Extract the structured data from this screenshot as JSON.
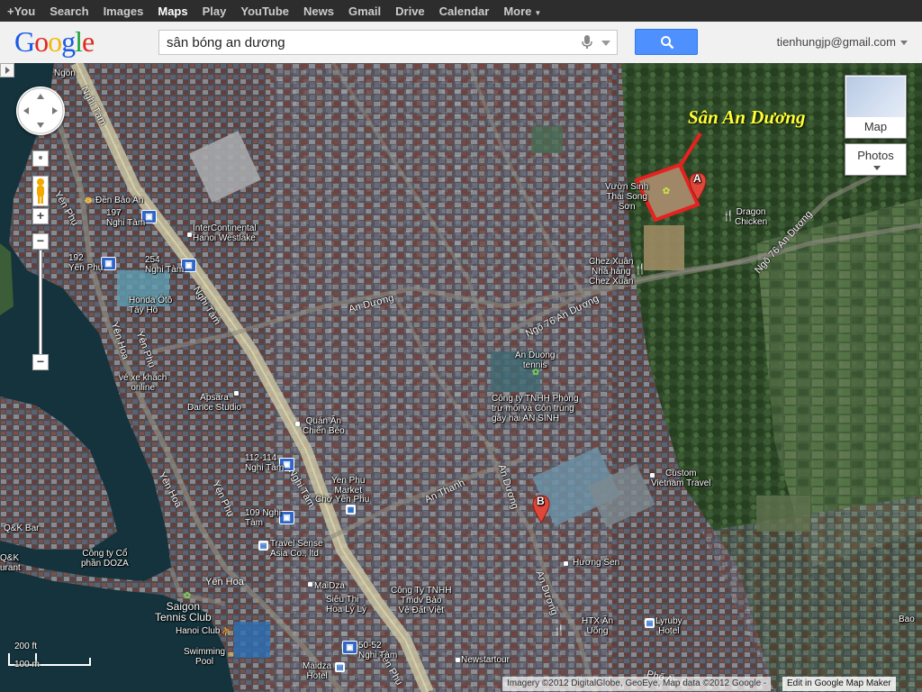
{
  "topbar": {
    "items": [
      "+You",
      "Search",
      "Images",
      "Maps",
      "Play",
      "YouTube",
      "News",
      "Gmail",
      "Drive",
      "Calendar",
      "More"
    ],
    "active": "Maps"
  },
  "header": {
    "logo": "Google",
    "search_value": "sân bóng an dương",
    "account": "tienhungjp@gmail.com"
  },
  "map_controls": {
    "map_type_label": "Map",
    "photos_label": "Photos",
    "zoom_in": "+",
    "zoom_out": "−"
  },
  "annotation": {
    "title": "Sân An Dương",
    "outline_color": "#e8201f",
    "title_color": "#ffff33"
  },
  "markers": {
    "a": "A",
    "b": "B",
    "color": "#e0463a"
  },
  "scale": {
    "feet": "200 ft",
    "meters": "100 m"
  },
  "roads": {
    "nghi_tam_1": "Nghi Tàm",
    "nghi_tam_2": "Nghi Tàm",
    "nghi_tam_3": "Nghi Tàm",
    "yen_phu_1": "Yên Phụ",
    "yen_phu_2": "Yên Phụ",
    "yen_phu_3": "Yên Phụ",
    "yen_phu_4": "Yên Phụ",
    "yen_hoa_1": "Yên Hoa",
    "yen_hoa_2": "Yên Hoa",
    "yen_hoa_3": "Yên Hoa",
    "an_duong_1": "An Dương",
    "an_duong_2": "An Dương",
    "an_duong_3": "An Dương",
    "ngo76_1": "Ngõ 76 An Dương",
    "ngo76_2": "Ngõ 76 An Dương",
    "an_thanh": "An Thanh",
    "pho_an": "Phố An D..."
  },
  "places": {
    "den_bao_an": "Đền Bảo An",
    "bus_197": "197\nNghi Tàm",
    "intercontinental": "InterContinental\nHanoi Westlake",
    "bus_192": "192\nYên Phụ",
    "bus_254": "254\nNghi Tàm",
    "honda": "Honda Ôtô\nTây Hồ",
    "ve_xe": "vé xe khách\nonline",
    "apsara": "Apsara\nDance Studio",
    "quan_an": "Quán Ăn\nChiến Béo",
    "bus_112": "112-114\nNghi Tàm",
    "bus_109": "109 Nghi\nTàm",
    "yen_phu_market": "Yen Phu\nMarket",
    "cho_yen_phu": "Chợ Yên Phụ",
    "travel_sense": "Travel Sense\nAsia Co., ltd",
    "qk_bar": "Q&K Bar",
    "qk_restaurant": "Q&K\nurant",
    "cong_ty_doza": "Công ty Cổ\nphần DOZA",
    "saigon_tennis": "Saigon\nTennis Club",
    "hanoi_club": "Hanoi Club",
    "swimming_pool": "Swimming\nPool",
    "maidza": "MaiDza",
    "maidza_hotel": "Maidza\nHotel",
    "sieu_thi": "Siêu Thị\nHoa Lý Lý",
    "cong_ty_tmdv": "Công Ty TNHH\nTmdv Bảo\nVệ Đất Việt",
    "bus_5052": "50-52\nNghi Tàm",
    "an_duong_tennis": "An Duong\ntennis",
    "cong_ty_phong": "Công ty TNHH Phòng\ntrừ mối và Côn trùng\ngây hại AN SINH",
    "custom_vietnam": "Custom\nVietnam Travel",
    "huong_sen": "Hương Sen",
    "htx_an_uong": "HTX Ăn\nUống",
    "lyruby": "Lyruby\nHotel",
    "newstartour": "Newstartour",
    "vuon_sinh": "Vườn Sinh\nThái Song\nSơn",
    "dragon_chicken": "Dragon\nChicken",
    "chez_xuan": "Chez Xuân\nNhà hàng\nChez Xuân",
    "ngon": "Ngon",
    "bao": "Bao"
  },
  "attribution": {
    "text": "Imagery ©2012 DigitalGlobe, GeoEye, Map data ©2012 Google -",
    "edit_link": "Edit in Google Map Maker"
  }
}
